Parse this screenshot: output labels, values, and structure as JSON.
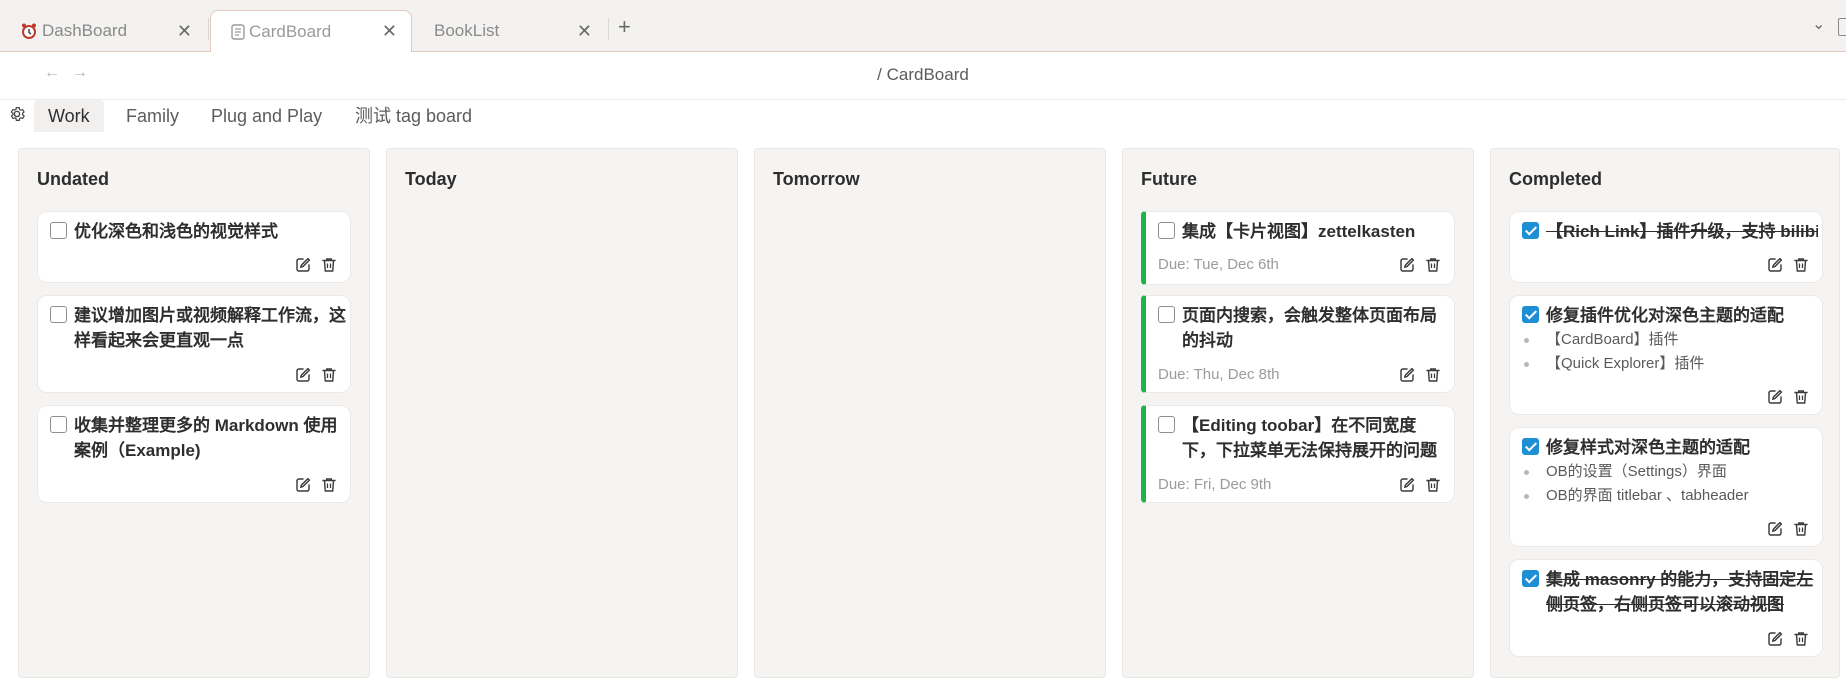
{
  "tabs": [
    {
      "label": "DashBoard",
      "icon": "alarm-clock-icon",
      "active": false
    },
    {
      "label": "CardBoard",
      "icon": "document-icon",
      "active": true
    },
    {
      "label": "BookList",
      "active": false
    }
  ],
  "nav": {
    "title": "/ CardBoard"
  },
  "board_tabs": [
    "Work",
    "Family",
    "Plug and Play",
    "测试 tag board"
  ],
  "columns": [
    {
      "title": "Undated",
      "cards": [
        {
          "title": "优化深色和浅色的视觉样式"
        },
        {
          "title": "建议增加图片或视频解释工作流，这样看起来会更直观一点"
        },
        {
          "title": "收集并整理更多的 Markdown 使用案例（Example)"
        }
      ]
    },
    {
      "title": "Today",
      "cards": []
    },
    {
      "title": "Tomorrow",
      "cards": []
    },
    {
      "title": "Future",
      "cards": [
        {
          "title": "集成【卡片视图】zettelkasten",
          "due": "Due: Tue, Dec 6th"
        },
        {
          "title": "页面内搜索，会触发整体页面布局的抖动",
          "due": "Due: Thu, Dec 8th"
        },
        {
          "title": "【Editing toobar】在不同宽度下，下拉菜单无法保持展开的问题",
          "due": "Due: Fri, Dec 9th"
        }
      ]
    },
    {
      "title": "Completed",
      "cards": [
        {
          "title": "【Rich Link】插件升级，支持 bilibili",
          "done": true,
          "struck": true
        },
        {
          "title": "修复插件优化对深色主题的适配",
          "done": true,
          "items": [
            "【CardBoard】插件",
            "【Quick Explorer】插件"
          ]
        },
        {
          "title": "修复样式对深色主题的适配",
          "done": true,
          "items": [
            "OB的设置（Settings）界面",
            "OB的界面 titlebar 、tabheader"
          ]
        },
        {
          "title": "集成 masonry 的能力，支持固定左侧页签，右侧页签可以滚动视图",
          "done": true,
          "struck": true
        }
      ]
    }
  ],
  "colors": {
    "due_bar": "#22b24c",
    "checkbox_checked": "#1e8fd5"
  }
}
